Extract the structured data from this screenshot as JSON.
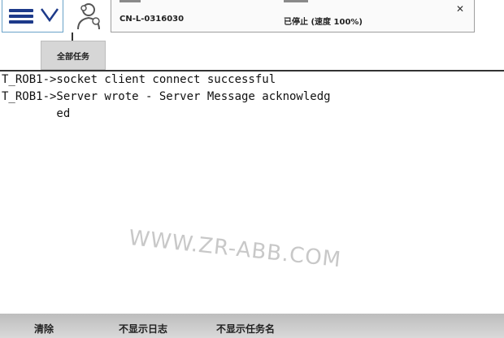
{
  "header": {
    "controller_name": "CN-L-0316030",
    "controller_state": "已停止 (速度 100%)",
    "close_glyph": "✕"
  },
  "tabs": [
    {
      "label": "全部任务"
    }
  ],
  "log": {
    "lines": [
      "T_ROB1->socket client connect successful",
      "T_ROB1->Server wrote - Server Message acknowledg",
      "        ed"
    ]
  },
  "watermark": "WWW.ZR-ABB.COM",
  "bottom_bar": {
    "clear": "清除",
    "hide_log": "不显示日志",
    "hide_task_name": "不显示任务名"
  },
  "colors": {
    "accent": "#1d3a8a",
    "frame": "#6aa2c8"
  },
  "icons": {
    "menu": "hamburger-menu-icon",
    "chevron": "chevron-down-icon",
    "robot": "robot-operator-icon",
    "close": "close-icon"
  }
}
